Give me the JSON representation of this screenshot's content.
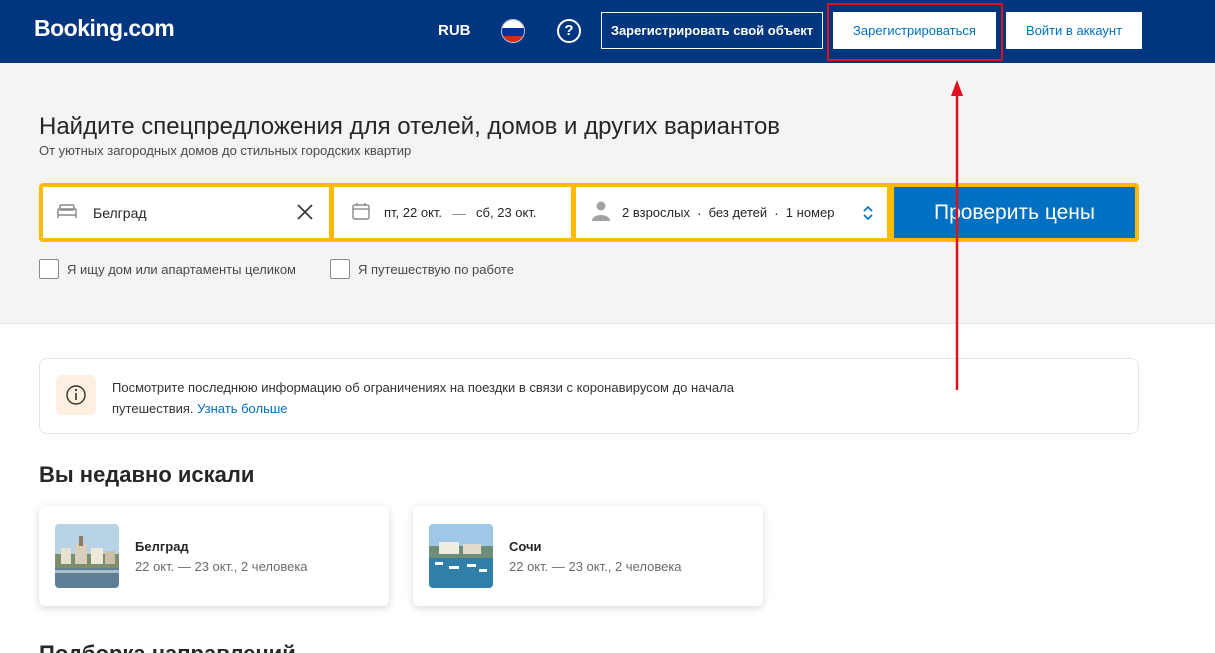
{
  "header": {
    "logo": "Booking.com",
    "currency": "RUB",
    "help_label": "?",
    "list_property_label": "Зарегистрировать свой объект",
    "register_label": "Зарегистрироваться",
    "signin_label": "Войти в аккаунт",
    "bg_color": "#003580"
  },
  "hero": {
    "title": "Найдите спецпредложения для отелей, домов и других вариантов",
    "subtitle": "От уютных загородных домов до стильных городских квартир"
  },
  "search": {
    "destination": "Белград",
    "checkin": "пт, 22 окт.",
    "date_separator": "—",
    "checkout": "сб, 23 окт.",
    "adults": "2 взрослых",
    "children": "без детей",
    "rooms": "1 номер",
    "dot": "·",
    "submit_label": "Проверить цены",
    "accent_color": "#febb02",
    "button_color": "#0071c2"
  },
  "checkboxes": [
    {
      "label": "Я ищу дом или апартаменты целиком"
    },
    {
      "label": "Я путешествую по работе"
    }
  ],
  "notice": {
    "text": "Посмотрите последнюю информацию об ограничениях на поездки в связи с коронавирусом до начала путешествия.",
    "link_label": "Узнать больше"
  },
  "recent": {
    "title": "Вы недавно искали",
    "items": [
      {
        "city": "Белград",
        "dates": "22 окт. — 23 окт., 2 человека"
      },
      {
        "city": "Сочи",
        "dates": "22 окт. — 23 окт., 2 человека"
      }
    ]
  },
  "next_section_title": "Подборка направлений",
  "annotation": {
    "color": "#e0101f"
  }
}
